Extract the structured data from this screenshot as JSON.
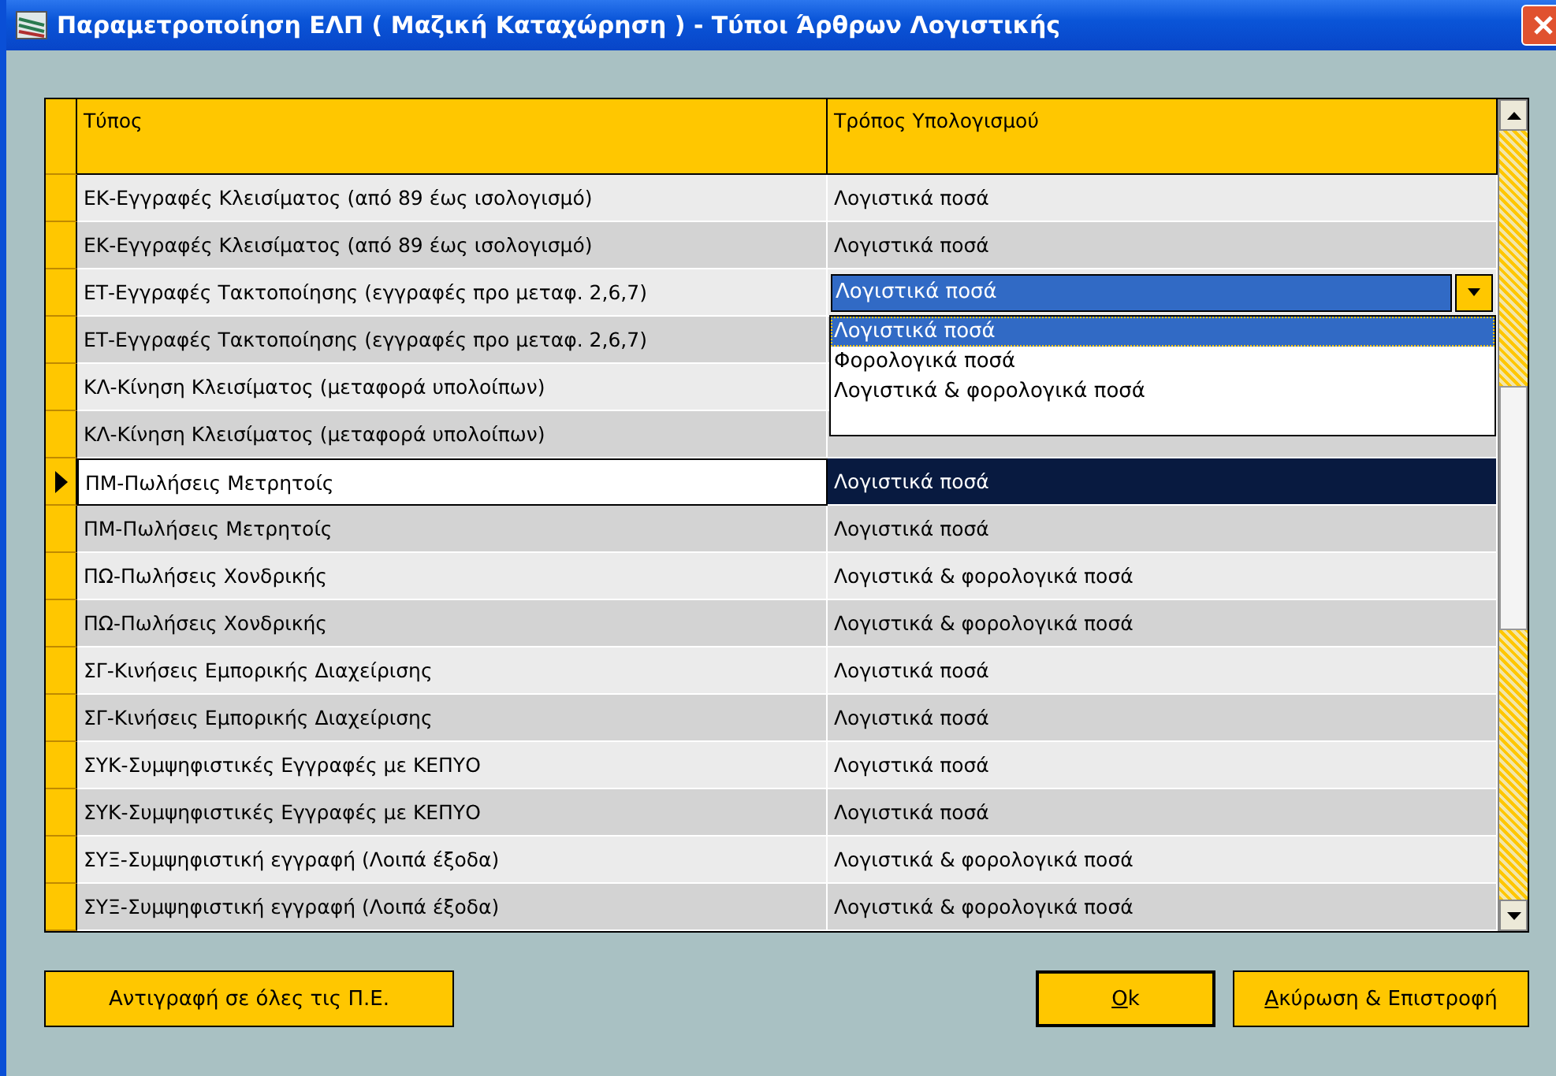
{
  "window": {
    "title": "Παραμετροποίηση ΕΛΠ ( Μαζική Καταχώρηση ) - Τύποι Άρθρων Λογιστικής"
  },
  "table": {
    "columns": [
      "Τύπος",
      "Τρόπος Υπολογισμού"
    ],
    "rows": [
      {
        "type": "ΕΚ-Εγγραφές Κλεισίματος (από 89 έως ισολογισμό)",
        "method": "Λογιστικά ποσά",
        "selected": false
      },
      {
        "type": "ΕΚ-Εγγραφές Κλεισίματος (από 89 έως ισολογισμό)",
        "method": "Λογιστικά ποσά",
        "selected": false
      },
      {
        "type": "ΕΤ-Εγγραφές Τακτοποίησης (εγγραφές προ μεταφ. 2,6,7)",
        "selected": false,
        "dropdown": {
          "value": "Λογιστικά ποσά",
          "options": [
            {
              "label": "Λογιστικά ποσά",
              "selected": true
            },
            {
              "label": "Φορολογικά ποσά",
              "selected": false
            },
            {
              "label": "Λογιστικά & φορολογικά ποσά",
              "selected": false
            }
          ]
        }
      },
      {
        "type": "ΕΤ-Εγγραφές Τακτοποίησης (εγγραφές προ μεταφ. 2,6,7)",
        "selected": false
      },
      {
        "type": "ΚΛ-Κίνηση Κλεισίματος (μεταφορά υπολοίπων)",
        "selected": false
      },
      {
        "type": "ΚΛ-Κίνηση Κλεισίματος (μεταφορά υπολοίπων)",
        "selected": false
      },
      {
        "type": "ΠΜ-Πωλήσεις Μετρητοίς",
        "method": "Λογιστικά ποσά",
        "selected": true
      },
      {
        "type": "ΠΜ-Πωλήσεις Μετρητοίς",
        "method": "Λογιστικά ποσά",
        "selected": false
      },
      {
        "type": "ΠΩ-Πωλήσεις Χονδρικής",
        "method": "Λογιστικά & φορολογικά ποσά",
        "selected": false
      },
      {
        "type": "ΠΩ-Πωλήσεις Χονδρικής",
        "method": "Λογιστικά & φορολογικά ποσά",
        "selected": false
      },
      {
        "type": "ΣΓ-Κινήσεις Εμπορικής Διαχείρισης",
        "method": "Λογιστικά ποσά",
        "selected": false
      },
      {
        "type": "ΣΓ-Κινήσεις Εμπορικής Διαχείρισης",
        "method": "Λογιστικά ποσά",
        "selected": false
      },
      {
        "type": "ΣΥΚ-Συμψηφιστικές Εγγραφές με ΚΕΠΥΟ",
        "method": "Λογιστικά ποσά",
        "selected": false
      },
      {
        "type": "ΣΥΚ-Συμψηφιστικές Εγγραφές με ΚΕΠΥΟ",
        "method": "Λογιστικά ποσά",
        "selected": false
      },
      {
        "type": "ΣΥΞ-Συμψηφιστική εγγραφή (Λοιπά έξοδα)",
        "method": "Λογιστικά & φορολογικά ποσά",
        "selected": false
      },
      {
        "type": "ΣΥΞ-Συμψηφιστική εγγραφή (Λοιπά έξοδα)",
        "method": "Λογιστικά & φορολογικά ποσά",
        "selected": false
      }
    ]
  },
  "buttons": [
    {
      "label": "Αντιγραφή σε όλες τις Π.Ε.",
      "kind": "copy",
      "underline_first": false,
      "default": false
    },
    {
      "label": "Ok",
      "kind": "ok",
      "underline_first": true,
      "default": true
    },
    {
      "label": "Ακύρωση & Επιστροφή",
      "kind": "cancel",
      "underline_first": true,
      "default": false
    }
  ]
}
